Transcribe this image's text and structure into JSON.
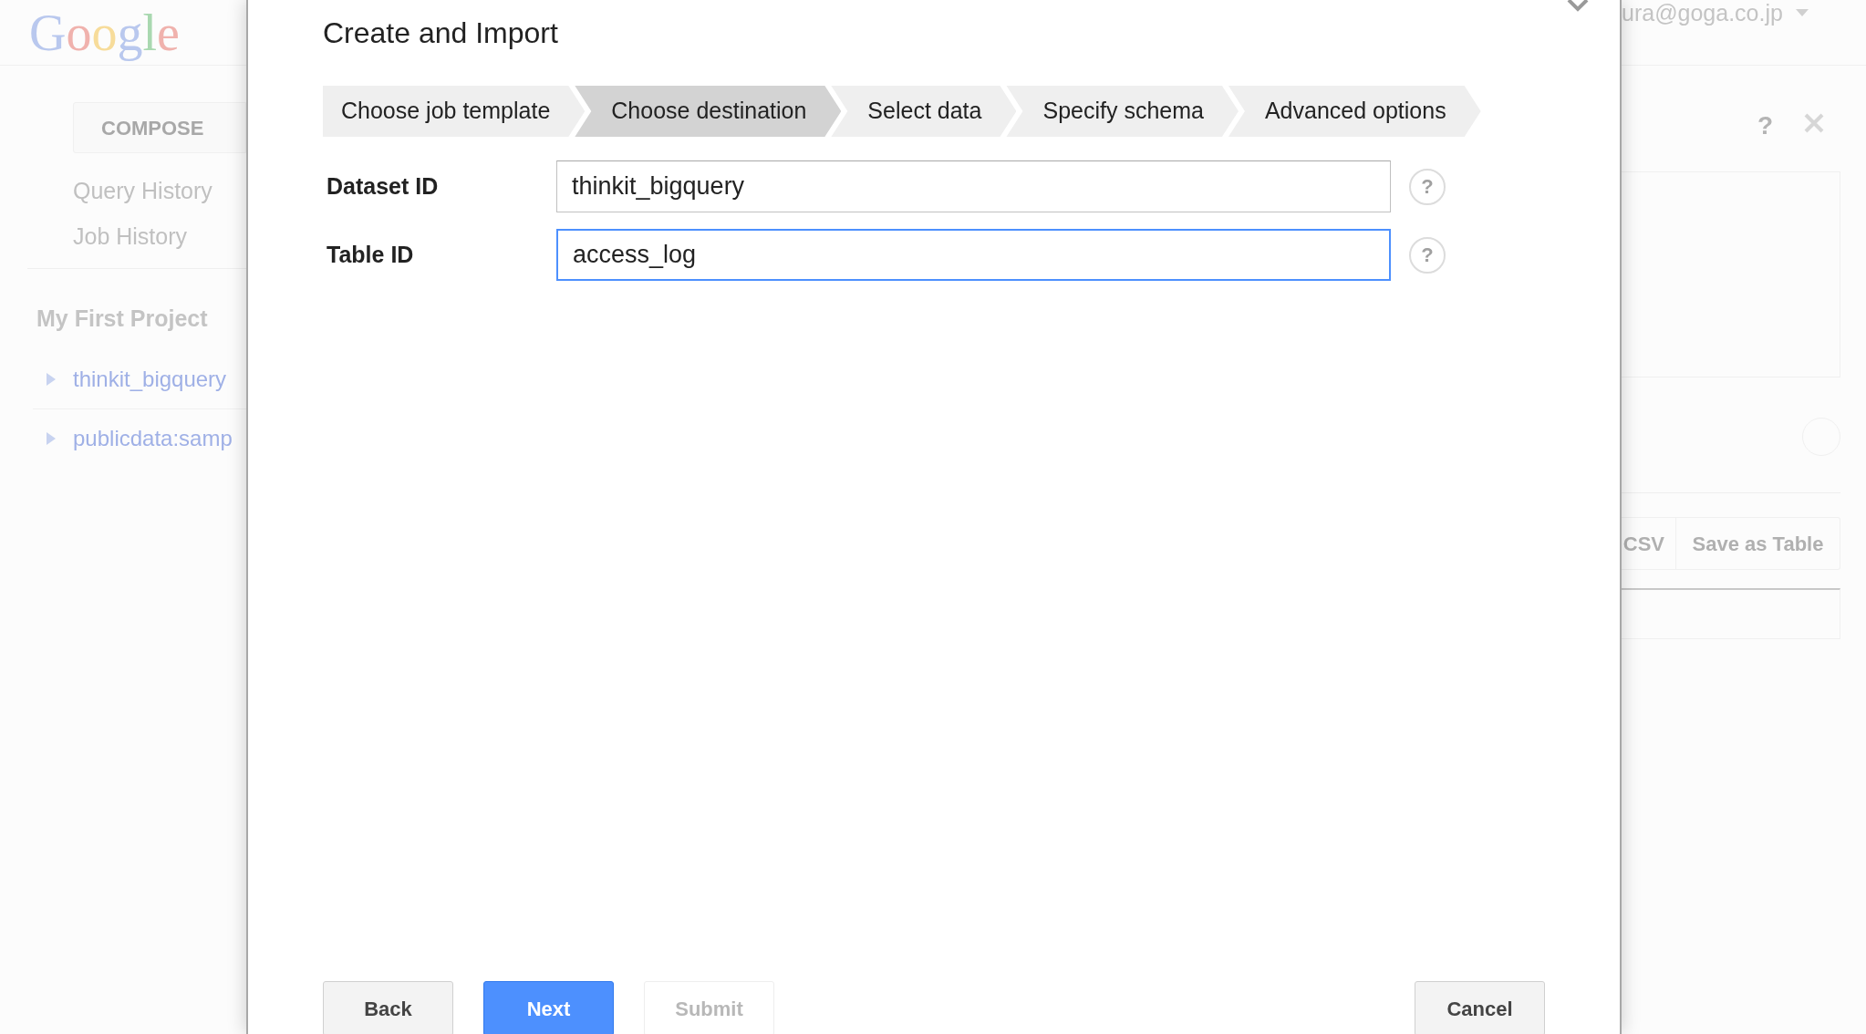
{
  "background": {
    "logo": "Google",
    "account": "ura@goga.co.jp",
    "compose": "COMPOSE",
    "nav": [
      "Query History",
      "Job History"
    ],
    "project": "My First Project",
    "datasets": [
      {
        "name": "thinkit_bigquery",
        "expanded": false
      },
      {
        "name": "publicdata:samp",
        "expanded": false
      }
    ],
    "panel_buttons": [
      "CSV",
      "Save as Table"
    ],
    "help": "?"
  },
  "dialog": {
    "title": "Create and Import",
    "steps": [
      {
        "label": "Choose job template",
        "selected": false
      },
      {
        "label": "Choose destination",
        "selected": true
      },
      {
        "label": "Select data",
        "selected": false
      },
      {
        "label": "Specify schema",
        "selected": false
      },
      {
        "label": "Advanced options",
        "selected": false
      }
    ],
    "fields": [
      {
        "label": "Dataset ID",
        "value": "thinkit_bigquery",
        "focused": false,
        "help": "?"
      },
      {
        "label": "Table ID",
        "value": "access_log",
        "focused": true,
        "help": "?"
      }
    ],
    "buttons": [
      {
        "label": "Back",
        "kind": "default",
        "disabled": false
      },
      {
        "label": "Next",
        "kind": "primary",
        "disabled": false
      },
      {
        "label": "Submit",
        "kind": "default",
        "disabled": true
      }
    ],
    "cancel": {
      "label": "Cancel",
      "kind": "default",
      "disabled": false
    }
  }
}
